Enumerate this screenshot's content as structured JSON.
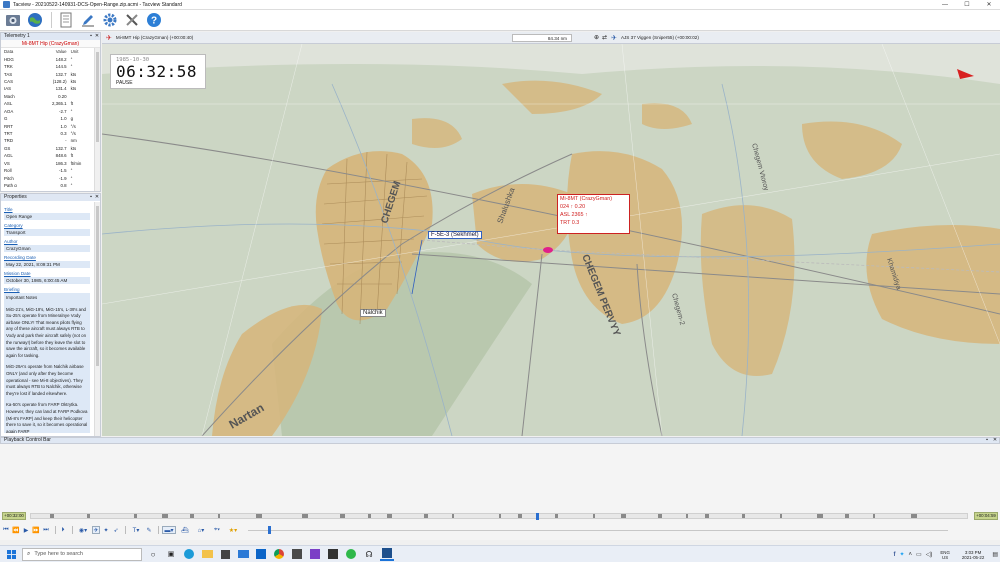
{
  "window": {
    "title": "Tacview - 20210522-140931-DCS-Open-Range.zip.acmi - Tacview Standard",
    "controls": {
      "minimize": "—",
      "maximize": "☐",
      "close": "✕"
    }
  },
  "toolbar": {
    "buttons": [
      "open-icon",
      "globe-icon",
      "document-icon",
      "edit-icon",
      "settings-icon",
      "tools-icon",
      "help-icon"
    ]
  },
  "telemetry": {
    "header": "Telemetry 1",
    "subject": "Mi-8MT Hip (CrazyGman)",
    "columns": [
      "Data",
      "Value",
      "Unit"
    ],
    "rows": [
      [
        "HDG",
        "148.2",
        "°"
      ],
      [
        "TRK",
        "144.5",
        "°"
      ],
      [
        "TAS",
        "132.7",
        "kts"
      ],
      [
        "CAS",
        "(128.2)",
        "kts"
      ],
      [
        "IAS",
        "131.4",
        "kts"
      ],
      [
        "Mach",
        "0.20",
        ""
      ],
      [
        "ASL",
        "2,365.1",
        "ft"
      ],
      [
        "AOA",
        "-2.7",
        "°"
      ],
      [
        "G",
        "1.0",
        "g"
      ],
      [
        "RRT",
        "1.0",
        "°/s"
      ],
      [
        "TRT",
        "0.3",
        "°/s"
      ],
      [
        "TRD",
        "-",
        "nm"
      ],
      [
        "GS",
        "132.7",
        "kts"
      ],
      [
        "AGL",
        "848.6",
        "ft"
      ],
      [
        "VS",
        "186.3",
        "ft/min"
      ],
      [
        "Roll",
        "-1.5",
        "°"
      ],
      [
        "Pitch",
        "-1.9",
        "°"
      ],
      [
        "Path α",
        "0.8",
        "°"
      ]
    ]
  },
  "properties": {
    "header": "Properties",
    "fields": [
      {
        "label": "Title",
        "value": "Open Range"
      },
      {
        "label": "Category",
        "value": "Transport"
      },
      {
        "label": "Author",
        "value": "CrazyGman"
      },
      {
        "label": "Recording Date",
        "value": "May 22, 2021, 8:09:31 PM"
      },
      {
        "label": "Mission Date",
        "value": "October 30, 1985, 6:00:45 AM"
      }
    ],
    "briefing_label": "Briefing",
    "briefing": [
      "Important Notes",
      "MiG-21's, MiG-19's, MiG-15's, L-39's and Su-25's operate from Mineralnye Vody airbase ONLY! That means pilots flying any of these aircraft must always RTB to Vody and park their aircraft safely (not on the runway!) before they leave the slot to save the aircraft, so it becomes available again for tasking.",
      "MiG-29A's operate from Nalchik airbase ONLY (and only after they become operational - see Mi-8 objectives). They must always RTB to Nalchik, otherwise they're lost if landed elsewhere.",
      "Ka-50's operate from FARP Oktrytka. However, they can land at FARP Podkova (Mi-8's FARP) and keep their helicopter there to save it, so it becomes operational again FARP"
    ]
  },
  "viewport": {
    "object_left": "Mi-8MT Hip (CrazyGman) (+00:00:40)",
    "distance": "84.34 nm",
    "object_right": "AJS 37 Viggen (Sniper55) (+00:00:02)",
    "clock": {
      "date": "1985-10-30",
      "time": "06:32:58",
      "state": "PAUSE"
    },
    "labels": {
      "nalchik": "Nalchik",
      "f5e": "F-5E-3 (Sekhmet)",
      "nartan": "Nartan",
      "chegem": "CHEGEM",
      "chegem2": "CHEGEM PERVYY",
      "shalushka": "Shalushka",
      "chegem_small": "Chegem-2",
      "khamidiya": "Khamidiya",
      "chegem_vtoroy": "Chegem Vtoroy"
    },
    "info": [
      "Mi-8MT (CrazyGman)",
      "024 ↑ 0.20",
      "ASL 2365 ↑",
      "TRT 0.3"
    ],
    "colors": {
      "town": "#d8b87a",
      "terrain": "#c9d4c0",
      "road": "#8a8a8a",
      "river": "#9ab3c8",
      "highlight": "#d02020"
    }
  },
  "playback": {
    "header": "Playback Control Bar",
    "start_time": "+00:32:00",
    "end_time": "+00:04:59",
    "position": 0.54
  },
  "taskbar": {
    "search_placeholder": "Type here to search",
    "lang_top": "ENG",
    "lang_bottom": "US",
    "time": "3:03 PM",
    "date": "2021-05-22"
  }
}
